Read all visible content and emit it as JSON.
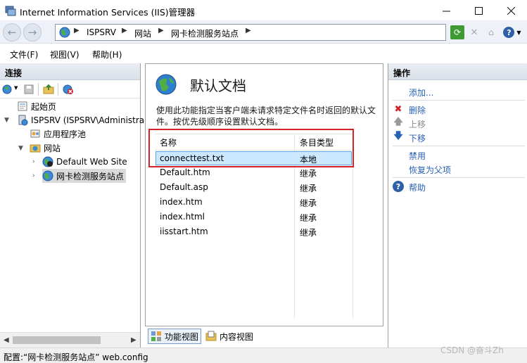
{
  "window": {
    "title": "Internet Information Services (IIS)管理器"
  },
  "address": {
    "crumbs": [
      "ISPSRV",
      "网站",
      "网卡检测服务站点"
    ]
  },
  "menu": {
    "items": [
      "文件(F)",
      "视图(V)",
      "帮助(H)"
    ]
  },
  "connections": {
    "header": "连接",
    "tree": [
      {
        "label": "起始页"
      },
      {
        "label": "ISPSRV (ISPSRV\\Administra"
      },
      {
        "label": "应用程序池"
      },
      {
        "label": "网站"
      },
      {
        "label": "Default Web Site"
      },
      {
        "label": "网卡检测服务站点"
      }
    ]
  },
  "feature": {
    "title": "默认文档",
    "description": "使用此功能指定当客户端未请求特定文件名时返回的默认文件。按优先级顺序设置默认文档。",
    "columns": [
      "名称",
      "条目类型"
    ],
    "rows": [
      {
        "name": "connecttest.txt",
        "type": "本地"
      },
      {
        "name": "Default.htm",
        "type": "继承"
      },
      {
        "name": "Default.asp",
        "type": "继承"
      },
      {
        "name": "index.htm",
        "type": "继承"
      },
      {
        "name": "index.html",
        "type": "继承"
      },
      {
        "name": "iisstart.htm",
        "type": "继承"
      }
    ],
    "selected_row": 0
  },
  "view_tabs": [
    "功能视图",
    "内容视图"
  ],
  "actions": {
    "header": "操作",
    "add": "添加...",
    "remove": "删除",
    "move_up": "上移",
    "move_down": "下移",
    "disable": "禁用",
    "revert": "恢复为父项",
    "help": "帮助"
  },
  "status": {
    "text": "配置:“网卡检测服务站点” web.config"
  },
  "watermark": "CSDN @奋斗Zh",
  "colors": {
    "accent": "#2a62b4",
    "selection": "#cce8ff",
    "highlight_border": "#d2232a"
  }
}
